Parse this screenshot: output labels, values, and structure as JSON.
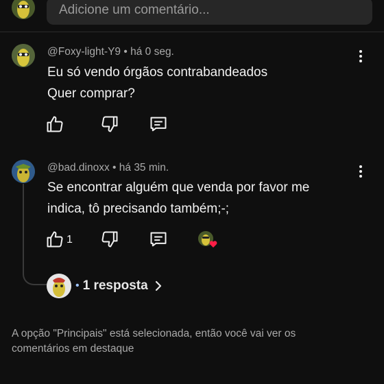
{
  "composer": {
    "placeholder": "Adicione um comentário..."
  },
  "comments": [
    {
      "author": "@Foxy-light-Y9",
      "time": "há 0 seg.",
      "text_lines": [
        "Eu só vendo órgãos contrabandeados",
        "Quer comprar?"
      ],
      "likes": ""
    },
    {
      "author": "@bad.dinoxx",
      "time": "há 35 min.",
      "text_lines": [
        "Se encontrar alguém que venda por favor me",
        "indica, tô precisando também;-;"
      ],
      "likes": "1"
    }
  ],
  "replies": {
    "dot": "•",
    "label": "1 resposta"
  },
  "footer": {
    "lines": [
      "A opção \"Principais\" está selecionada, então você vai ver os",
      "comentários em destaque"
    ]
  },
  "icons": {
    "like": "thumbs-up-icon",
    "dislike": "thumbs-down-icon",
    "reply": "reply-comment-icon",
    "more": "more-vertical-icon",
    "chevron": "chevron-right-icon",
    "creator_heart": "heart-icon"
  },
  "colors": {
    "background": "#0f0f0f",
    "heart": "#ff1e46",
    "link_dot": "#9fc4ff"
  }
}
